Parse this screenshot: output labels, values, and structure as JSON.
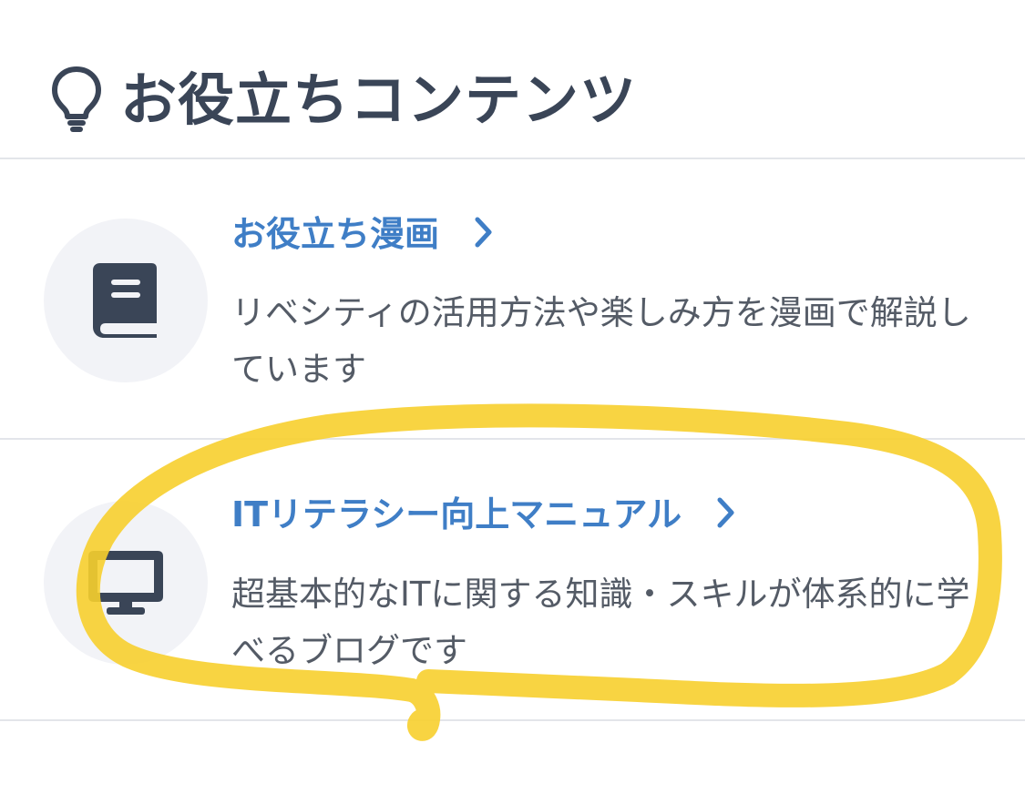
{
  "header": {
    "title": "お役立ちコンテンツ",
    "icon": "lightbulb-icon"
  },
  "items": [
    {
      "title": "お役立ち漫画",
      "description": "リベシティの活用方法や楽しみ方を漫画で解説しています",
      "icon": "book-icon"
    },
    {
      "title": "ITリテラシー向上マニュアル",
      "description": "超基本的なITに関する知識・スキルが体系的に学べるブログです",
      "icon": "desktop-monitor-icon"
    }
  ],
  "colors": {
    "title_text": "#3a4557",
    "link": "#3f7ec6",
    "body_text": "#545b66",
    "icon_fill": "#3a4557",
    "icon_circle": "#f2f3f7",
    "divider": "#e3e5ea",
    "highlight_marker": "#f7cf2e"
  }
}
